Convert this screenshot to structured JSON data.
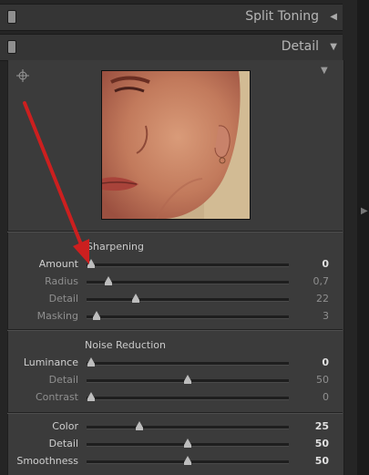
{
  "panels": {
    "split_toning": {
      "title": "Split Toning"
    },
    "detail": {
      "title": "Detail"
    }
  },
  "sharpening": {
    "title": "Sharpening",
    "rows": [
      {
        "label": "Amount",
        "value": "0",
        "level": 0.0,
        "active": true
      },
      {
        "label": "Radius",
        "value": "0,7",
        "level": 0.09,
        "active": false
      },
      {
        "label": "Detail",
        "value": "22",
        "level": 0.23,
        "active": false
      },
      {
        "label": "Masking",
        "value": "3",
        "level": 0.03,
        "active": false
      }
    ]
  },
  "noise_reduction": {
    "title": "Noise Reduction",
    "luminance_rows": [
      {
        "label": "Luminance",
        "value": "0",
        "level": 0.0,
        "active": true
      },
      {
        "label": "Detail",
        "value": "50",
        "level": 0.5,
        "active": false
      },
      {
        "label": "Contrast",
        "value": "0",
        "level": 0.0,
        "active": false
      }
    ],
    "color_rows": [
      {
        "label": "Color",
        "value": "25",
        "level": 0.25,
        "active": true
      },
      {
        "label": "Detail",
        "value": "50",
        "level": 0.5,
        "active": true
      },
      {
        "label": "Smoothness",
        "value": "50",
        "level": 0.5,
        "active": true
      }
    ]
  },
  "colors": {
    "annotation_arrow": "#cc1f1f",
    "panel_bg": "#3b3b3b",
    "header_bg": "#353535"
  },
  "icons": {
    "targeted_adjust": "crosshair-icon",
    "panel_collapse": "triangle-left-icon",
    "panel_expand": "triangle-down-icon"
  }
}
